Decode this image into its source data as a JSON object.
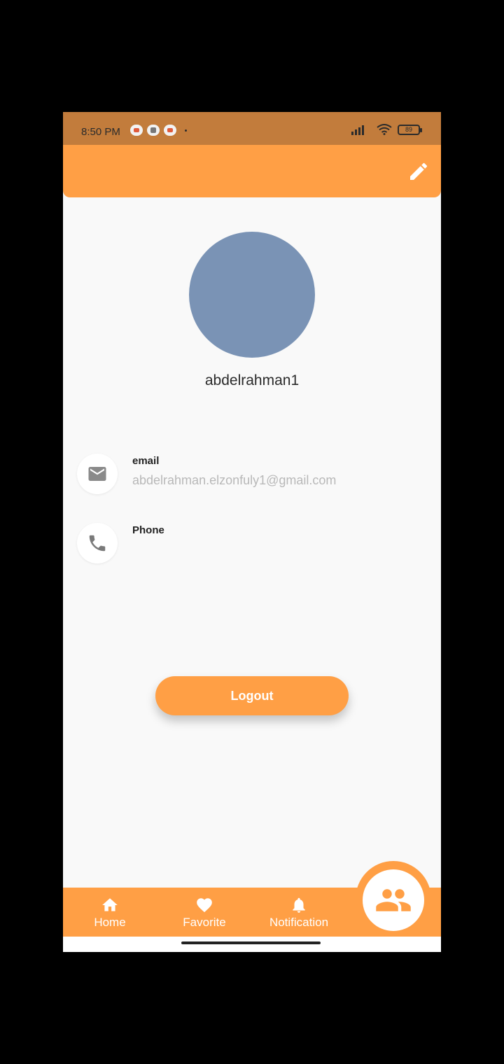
{
  "status_bar": {
    "time": "8:50 PM",
    "battery": "89"
  },
  "profile": {
    "username": "abdelrahman1"
  },
  "info": {
    "email_label": "email",
    "email_value": "abdelrahman.elzonfuly1@gmail.com",
    "phone_label": "Phone",
    "phone_value": ""
  },
  "actions": {
    "logout_label": "Logout"
  },
  "bottom_nav": {
    "items": [
      {
        "label": "Home",
        "icon": "home-icon"
      },
      {
        "label": "Favorite",
        "icon": "heart-icon"
      },
      {
        "label": "Notification",
        "icon": "bell-icon"
      }
    ],
    "fab_icon": "group-icon"
  },
  "colors": {
    "accent": "#ff9f45",
    "status_bar": "#c27c3c",
    "avatar": "#7a93b5",
    "background": "#f9f9f9"
  }
}
